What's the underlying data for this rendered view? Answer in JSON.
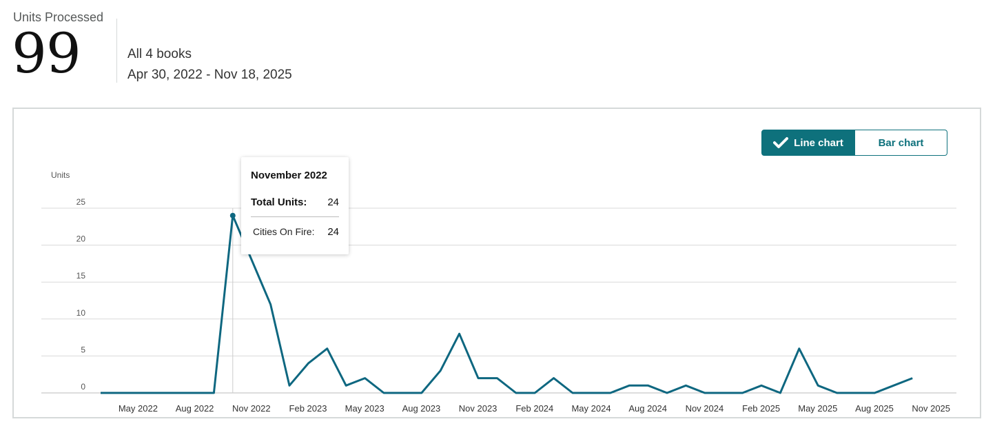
{
  "summary": {
    "label": "Units Processed",
    "total": "99",
    "books": "All 4 books",
    "date_range": "Apr 30, 2022 - Nov 18, 2025"
  },
  "toggle": {
    "line_label": "Line chart",
    "bar_label": "Bar chart",
    "selected": "Line chart",
    "accent_color": "#0e717c"
  },
  "tooltip": {
    "title": "November 2022",
    "total_label": "Total Units:",
    "total_value": "24",
    "book_label": "Cities On Fire:",
    "book_value": "24"
  },
  "chart_data": {
    "type": "line",
    "ylabel": "Units",
    "ylim": [
      0,
      25
    ],
    "y_ticks": [
      0,
      5,
      10,
      15,
      20,
      25
    ],
    "x_tick_labels": [
      "May 2022",
      "Aug 2022",
      "Nov 2022",
      "Feb 2023",
      "May 2023",
      "Aug 2023",
      "Nov 2023",
      "Feb 2024",
      "May 2024",
      "Aug 2024",
      "Nov 2024",
      "Feb 2025",
      "May 2025",
      "Aug 2025",
      "Nov 2025"
    ],
    "x": [
      "Apr 2022",
      "May 2022",
      "Jun 2022",
      "Jul 2022",
      "Aug 2022",
      "Sep 2022",
      "Oct 2022",
      "Nov 2022",
      "Dec 2022",
      "Jan 2023",
      "Feb 2023",
      "Mar 2023",
      "Apr 2023",
      "May 2023",
      "Jun 2023",
      "Jul 2023",
      "Aug 2023",
      "Sep 2023",
      "Oct 2023",
      "Nov 2023",
      "Dec 2023",
      "Jan 2024",
      "Feb 2024",
      "Mar 2024",
      "Apr 2024",
      "May 2024",
      "Jun 2024",
      "Jul 2024",
      "Aug 2024",
      "Sep 2024",
      "Oct 2024",
      "Nov 2024",
      "Dec 2024",
      "Jan 2025",
      "Feb 2025",
      "Mar 2025",
      "Apr 2025",
      "May 2025",
      "Jun 2025",
      "Jul 2025",
      "Aug 2025",
      "Sep 2025",
      "Oct 2025",
      "Nov 2025"
    ],
    "values": [
      0,
      0,
      0,
      0,
      0,
      0,
      0,
      24,
      18,
      12,
      1,
      4,
      6,
      1,
      2,
      0,
      0,
      0,
      3,
      8,
      2,
      2,
      0,
      0,
      2,
      0,
      0,
      0,
      1,
      1,
      0,
      1,
      0,
      0,
      0,
      1,
      0,
      6,
      1,
      0,
      0,
      0,
      1,
      2
    ],
    "highlighted": "Nov 2022",
    "grid": true,
    "line_color": "#0e6780"
  }
}
